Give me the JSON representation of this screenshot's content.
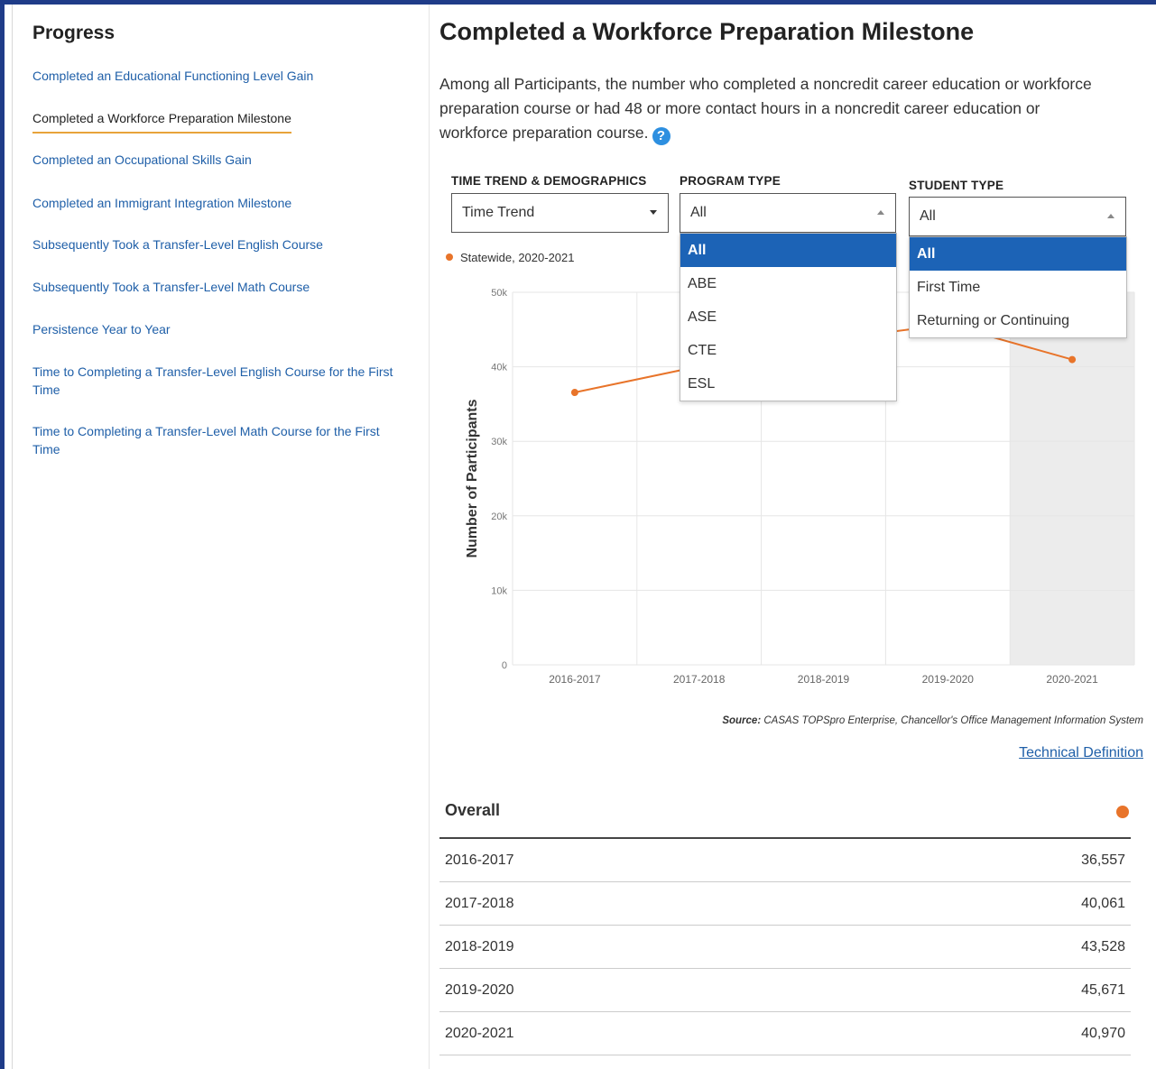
{
  "sidebar": {
    "title": "Progress",
    "items": [
      {
        "label": "Completed an Educational Functioning Level Gain",
        "active": false
      },
      {
        "label": "Completed a Workforce Preparation Milestone",
        "active": true
      },
      {
        "label": "Completed an Occupational Skills Gain",
        "active": false
      },
      {
        "label": "Completed an Immigrant Integration Milestone",
        "active": false
      },
      {
        "label": "Subsequently Took a Transfer-Level English Course",
        "active": false
      },
      {
        "label": "Subsequently Took a Transfer-Level Math Course",
        "active": false
      },
      {
        "label": "Persistence Year to Year",
        "active": false
      },
      {
        "label": "Time to Completing a Transfer-Level English Course for the First Time",
        "active": false
      },
      {
        "label": "Time to Completing a Transfer-Level Math Course for the First Time",
        "active": false
      }
    ]
  },
  "main": {
    "title": "Completed a Workforce Preparation Milestone",
    "description": "Among all Participants, the number who completed a noncredit career education or workforce preparation course or had 48 or more contact hours in a noncredit career education or workforce preparation course.",
    "help_icon": "question-circle-icon"
  },
  "filters": {
    "time_trend": {
      "label": "TIME TREND & DEMOGRAPHICS",
      "value": "Time Trend"
    },
    "program_type": {
      "label": "PROGRAM TYPE",
      "value": "All",
      "options": [
        "All",
        "ABE",
        "ASE",
        "CTE",
        "ESL"
      ]
    },
    "student_type": {
      "label": "STUDENT TYPE",
      "value": "All",
      "options": [
        "All",
        "First Time",
        "Returning or Continuing"
      ]
    }
  },
  "chart_data": {
    "type": "line",
    "title": "",
    "legend": "Statewide, 2020-2021",
    "ylabel": "Number of Participants",
    "xlabel": "",
    "categories": [
      "2016-2017",
      "2017-2018",
      "2018-2019",
      "2019-2020",
      "2020-2021"
    ],
    "series": [
      {
        "name": "Statewide, 2020-2021",
        "values": [
          36557,
          40061,
          43528,
          45671,
          40970
        ]
      }
    ],
    "ylim": [
      0,
      50000
    ],
    "yticks": [
      "0",
      "10k",
      "20k",
      "30k",
      "40k",
      "50k"
    ],
    "highlighted_category": "2020-2021",
    "line_color": "#e8742a",
    "grid": true
  },
  "source": {
    "prefix": "Source:",
    "text": "CASAS TOPSpro Enterprise, Chancellor's Office Management Information System"
  },
  "technical_definition": "Technical Definition",
  "table": {
    "header": "Overall",
    "rows": [
      {
        "year": "2016-2017",
        "value": "36,557"
      },
      {
        "year": "2017-2018",
        "value": "40,061"
      },
      {
        "year": "2018-2019",
        "value": "43,528"
      },
      {
        "year": "2019-2020",
        "value": "45,671"
      },
      {
        "year": "2020-2021",
        "value": "40,970"
      }
    ]
  }
}
